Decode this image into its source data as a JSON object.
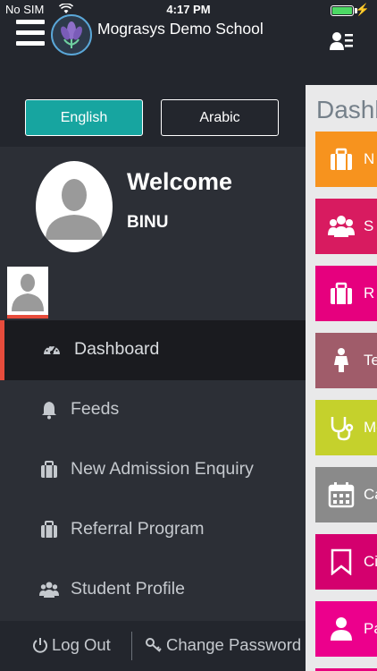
{
  "status": {
    "carrier": "No SIM",
    "time": "4:17 PM",
    "battery_level": 1.0
  },
  "header": {
    "title": "Mograsys Demo School",
    "menu_icon": "hamburger-icon",
    "logo_icon": "school-logo-flower",
    "profile_icon": "profile-card-icon"
  },
  "drawer": {
    "languages": {
      "english": "English",
      "arabic": "Arabic",
      "selected": "English"
    },
    "welcome": "Welcome",
    "username": "BINU",
    "menu": [
      {
        "label": "Dashboard",
        "icon": "speedometer-icon",
        "active": true
      },
      {
        "label": "Feeds",
        "icon": "bell-icon",
        "active": false
      },
      {
        "label": "New Admission Enquiry",
        "icon": "briefcase-icon",
        "active": false
      },
      {
        "label": "Referral Program",
        "icon": "briefcase-icon",
        "active": false
      },
      {
        "label": "Student Profile",
        "icon": "users-icon",
        "active": false
      }
    ],
    "footer": {
      "logout": "Log Out",
      "change_password": "Change Password"
    }
  },
  "dashboard": {
    "title": "Dashb",
    "tiles": [
      {
        "label": "N",
        "color": "#f7931e",
        "icon": "briefcase-icon"
      },
      {
        "label": "S",
        "color": "#d81b60",
        "icon": "users-icon"
      },
      {
        "label": "R",
        "color": "#e6007e",
        "icon": "briefcase-icon"
      },
      {
        "label": "Tea",
        "color": "#a05c6a",
        "icon": "teacher-icon"
      },
      {
        "label": "Me",
        "color": "#c5d12c",
        "icon": "stethoscope-icon"
      },
      {
        "label": "Ca",
        "color": "#8a8a8a",
        "icon": "calendar-icon"
      },
      {
        "label": "Cir",
        "color": "#d4006e",
        "icon": "bookmark-icon"
      },
      {
        "label": "Pa",
        "color": "#ec008c",
        "icon": "person-icon"
      }
    ]
  },
  "colors": {
    "accent_teal": "#17a5a0",
    "active_indicator": "#e74c3c",
    "drawer_bg": "#2c2f36",
    "header_bg": "#23262d"
  }
}
